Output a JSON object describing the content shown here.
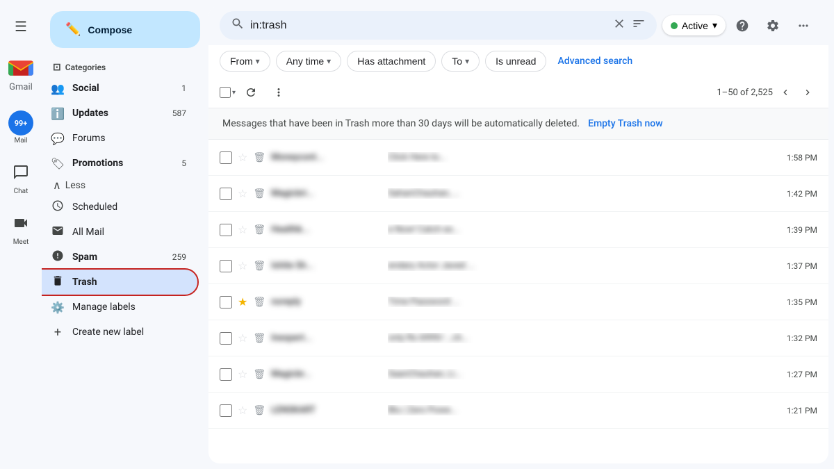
{
  "app": {
    "title": "Gmail",
    "search_value": "in:trash"
  },
  "topbar": {
    "hamburger_label": "☰",
    "active_label": "Active",
    "help_icon": "?",
    "settings_icon": "⚙",
    "apps_icon": "⋮⋮⋮"
  },
  "compose": {
    "label": "Compose"
  },
  "filters": {
    "from_label": "From",
    "anytime_label": "Any time",
    "has_attachment_label": "Has attachment",
    "to_label": "To",
    "is_unread_label": "Is unread",
    "advanced_label": "Advanced search"
  },
  "toolbar": {
    "page_info": "1–50 of 2,525"
  },
  "trash_notice": {
    "message": "Messages that have been in Trash more than 30 days will be automatically deleted.",
    "action": "Empty Trash now"
  },
  "sidebar": {
    "categories_label": "Categories",
    "items": [
      {
        "id": "social",
        "icon": "👥",
        "label": "Social",
        "count": "1"
      },
      {
        "id": "updates",
        "icon": "ℹ",
        "label": "Updates",
        "count": "587"
      },
      {
        "id": "forums",
        "icon": "💬",
        "label": "Forums",
        "count": ""
      },
      {
        "id": "promotions",
        "icon": "🏷",
        "label": "Promotions",
        "count": "5"
      },
      {
        "id": "less",
        "icon": "∧",
        "label": "Less",
        "count": ""
      },
      {
        "id": "scheduled",
        "icon": "🕐",
        "label": "Scheduled",
        "count": ""
      },
      {
        "id": "allmail",
        "icon": "✉",
        "label": "All Mail",
        "count": ""
      },
      {
        "id": "spam",
        "icon": "⚠",
        "label": "Spam",
        "count": "259"
      },
      {
        "id": "trash",
        "icon": "🗑",
        "label": "Trash",
        "count": ""
      }
    ],
    "manage_labels": "Manage labels",
    "create_new_label": "Create new label"
  },
  "left_nav": {
    "mail_label": "Mail",
    "chat_label": "Chat",
    "meet_label": "Meet",
    "badge": "99+"
  },
  "emails": [
    {
      "sender": "Moneycont...",
      "subject": "Click Here to...",
      "time": "1:58 PM",
      "starred": false
    },
    {
      "sender": "Magicbri...",
      "subject": "SahanChauhan, ...",
      "time": "1:42 PM",
      "starred": false
    },
    {
      "sender": "Healthk...",
      "subject": "e Now! Catch ex...",
      "time": "1:39 PM",
      "starred": false
    },
    {
      "sender": "Ishite Sh...",
      "subject": "endary Actor Javed ...",
      "time": "1:37 PM",
      "starred": false
    },
    {
      "sender": "noreply",
      "subject": "Time Password ...",
      "time": "1:35 PM",
      "starred": true
    },
    {
      "sender": "Inexpert...",
      "subject": "only Rs 6999/- , ch...",
      "time": "1:32 PM",
      "starred": false
    },
    {
      "sender": "Magicbr...",
      "subject": "SaanChauhan, Li...",
      "time": "1:27 PM",
      "starred": false
    },
    {
      "sender": "LENSKART",
      "subject": "Blu | Zero Powe...",
      "time": "1:21 PM",
      "starred": false
    }
  ]
}
